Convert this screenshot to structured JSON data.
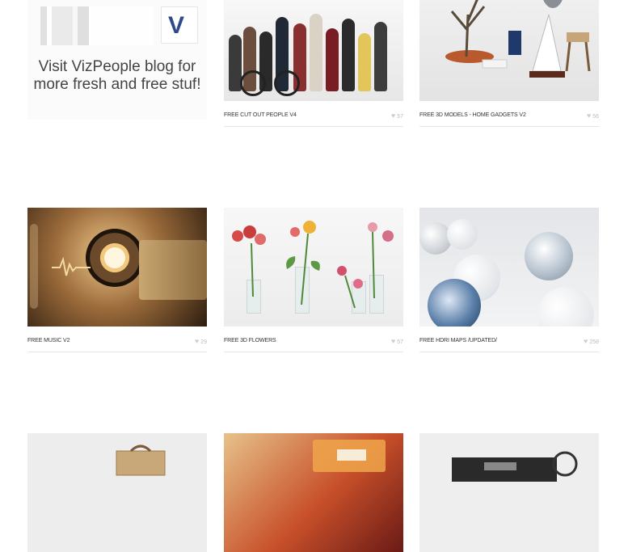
{
  "promo": {
    "line1": "Visit VizPeople blog for",
    "line2": "more fresh and free stuf!"
  },
  "icons": {
    "like": "heart-icon",
    "logo": "vizpeople-logo-icon"
  },
  "logo_letter": "V",
  "items": [
    {
      "title": "FREE CUT OUT PEOPLE V4",
      "likes": "57"
    },
    {
      "title": "FREE 3D MODELS - HOME GADGETS V2",
      "likes": "56"
    },
    {
      "title": "FREE MUSIC V2",
      "likes": "29"
    },
    {
      "title": "FREE 3D FLOWERS",
      "likes": "57"
    },
    {
      "title": "FREE HDRI MAPS /UPDATED/",
      "likes": "258"
    }
  ],
  "colors": {
    "logo_blue": "#2f4a8a",
    "title_text": "#333333",
    "likes_text": "#bbbbbb"
  }
}
